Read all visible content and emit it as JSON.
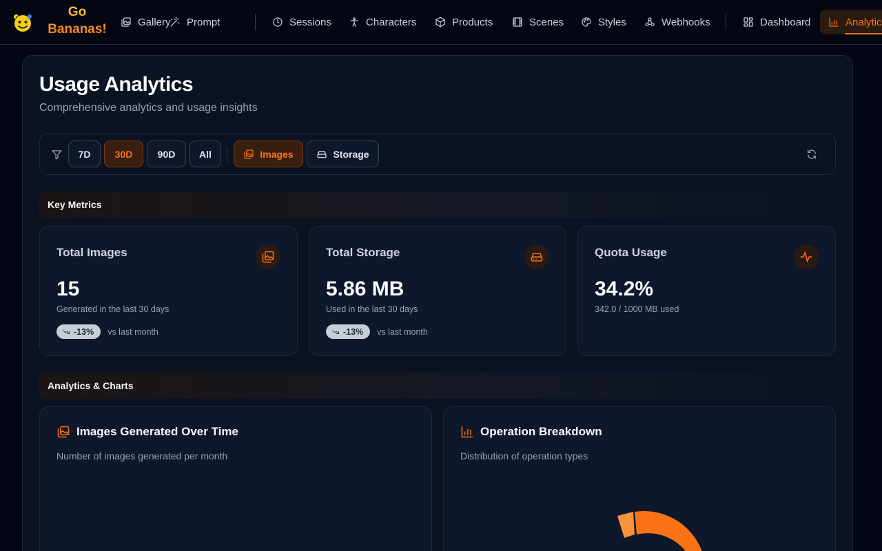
{
  "brand": {
    "name": "Go Bananas!"
  },
  "nav": {
    "gallery": "Gallery",
    "prompt": "Prompt",
    "sessions": "Sessions",
    "characters": "Characters",
    "products": "Products",
    "scenes": "Scenes",
    "styles": "Styles",
    "webhooks": "Webhooks",
    "dashboard": "Dashboard",
    "analytics": "Analytics"
  },
  "page": {
    "title": "Usage Analytics",
    "subtitle": "Comprehensive analytics and usage insights"
  },
  "filters": {
    "ranges": [
      "7D",
      "30D",
      "90D",
      "All"
    ],
    "selected_range": "30D",
    "metrics": [
      "Images",
      "Storage"
    ],
    "selected_metric": "Images"
  },
  "sections": {
    "key_metrics": "Key Metrics",
    "charts": "Analytics & Charts"
  },
  "cards": [
    {
      "title": "Total Images",
      "value": "15",
      "desc": "Generated in the last 30 days",
      "trend": "-13%",
      "trend_label": "vs last month",
      "icon": "image-icon"
    },
    {
      "title": "Total Storage",
      "value": "5.86 MB",
      "desc": "Used in the last 30 days",
      "trend": "-13%",
      "trend_label": "vs last month",
      "icon": "hard-drive-icon"
    },
    {
      "title": "Quota Usage",
      "value": "34.2%",
      "desc": "342.0 / 1000 MB used",
      "icon": "activity-icon"
    }
  ],
  "charts": [
    {
      "title": "Images Generated Over Time",
      "subtitle": "Number of images generated per month"
    },
    {
      "title": "Operation Breakdown",
      "subtitle": "Distribution of operation types"
    }
  ],
  "chart_data": {
    "type": "pie",
    "title": "Operation Breakdown",
    "colors": {
      "primary": "#f97316",
      "secondary": "#fb923c"
    }
  },
  "colors": {
    "accent": "#f97316",
    "background": "#020617",
    "surface": "#0f172a",
    "border": "#1e293b"
  }
}
